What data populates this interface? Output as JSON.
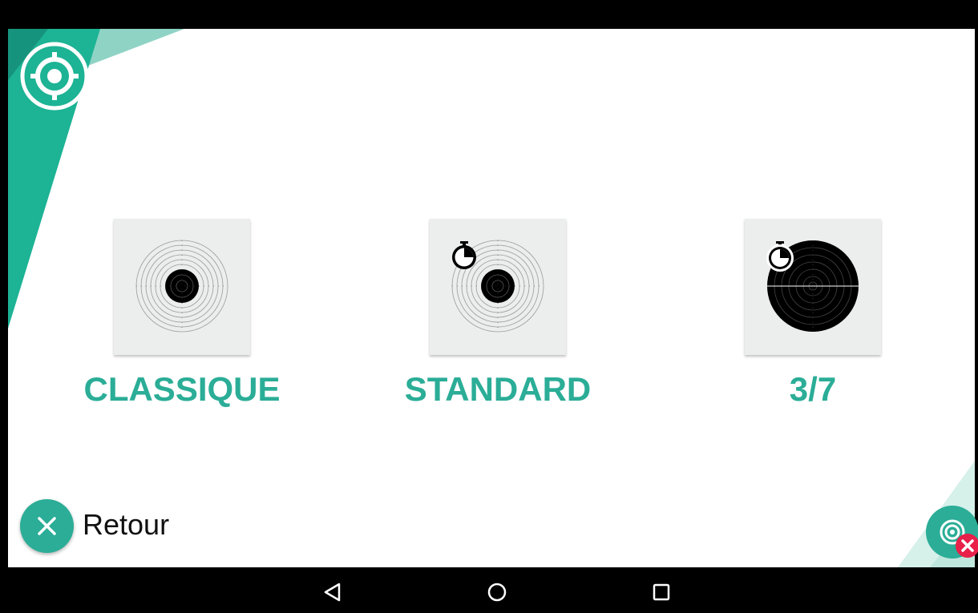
{
  "colors": {
    "accent": "#2bad97",
    "accent_light": "#8fd3c5",
    "card_bg": "#eceded",
    "danger": "#e8204a"
  },
  "icons": {
    "app_logo": "crosshair-target-icon",
    "stopwatch": "stopwatch-icon",
    "back": "close-icon",
    "target_off": "target-disconnected-icon",
    "nav_back": "triangle-back-icon",
    "nav_home": "circle-home-icon",
    "nav_recents": "square-recents-icon"
  },
  "modes": [
    {
      "label": "CLASSIQUE"
    },
    {
      "label": "STANDARD"
    },
    {
      "label": "3/7"
    }
  ],
  "back_button": {
    "label": "Retour"
  }
}
